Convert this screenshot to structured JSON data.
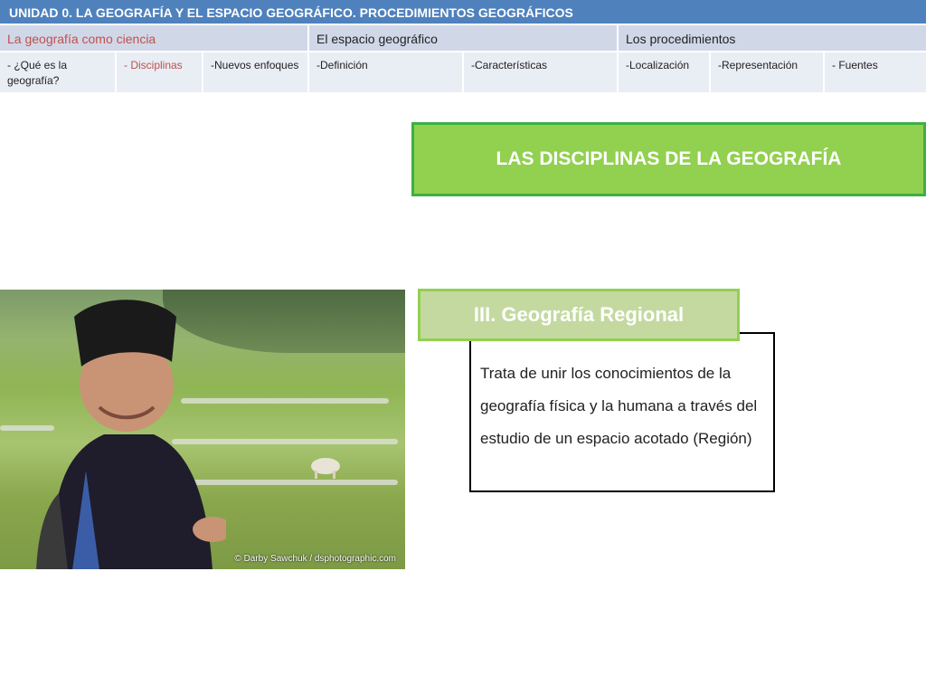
{
  "nav": {
    "title": "UNIDAD 0.  LA GEOGRAFÍA Y EL ESPACIO GEOGRÁFICO. PROCEDIMIENTOS GEOGRÁFICOS",
    "sections": [
      {
        "label": "La geografía como ciencia",
        "active": true
      },
      {
        "label": "El espacio geográfico"
      },
      {
        "label": "Los procedimientos"
      }
    ],
    "subsections": [
      {
        "label": "-  ¿Qué es la geografía?"
      },
      {
        "label": "- Disciplinas",
        "active": true
      },
      {
        "label": "-Nuevos enfoques"
      },
      {
        "label": "-Definición"
      },
      {
        "label": "-Características"
      },
      {
        "label": "-Localización"
      },
      {
        "label": "-Representación"
      },
      {
        "label": "- Fuentes"
      }
    ]
  },
  "banner": {
    "title": "LAS DISCIPLINAS DE LA GEOGRAFÍA"
  },
  "regional": {
    "heading": "III. Geografía Regional",
    "text": "Trata de unir los conocimientos de la geografía física y la humana a través del estudio de un espacio acotado (Región)"
  },
  "photo": {
    "credit": "© Darby Sawchuk / dsphotographic.com"
  },
  "colors": {
    "header_blue": "#4f81bd",
    "active_red": "#c0504d",
    "banner_green": "#92d050"
  }
}
